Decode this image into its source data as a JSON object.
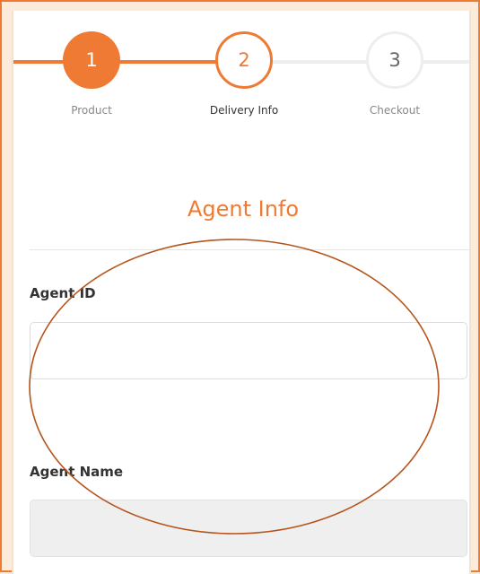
{
  "stepper": {
    "steps": [
      {
        "number": "1",
        "label": "Product",
        "state": "completed"
      },
      {
        "number": "2",
        "label": "Delivery Info",
        "state": "current"
      },
      {
        "number": "3",
        "label": "Checkout",
        "state": "upcoming"
      }
    ]
  },
  "section": {
    "title": "Agent Info"
  },
  "form": {
    "agent_id": {
      "label": "Agent ID",
      "value": "",
      "placeholder": ""
    },
    "agent_name": {
      "label": "Agent Name",
      "value": "",
      "placeholder": ""
    }
  },
  "colors": {
    "accent": "#ef7a33",
    "page_background": "#fcebd9",
    "annotation_stroke": "#b5541b",
    "inactive": "#eeeeee"
  }
}
